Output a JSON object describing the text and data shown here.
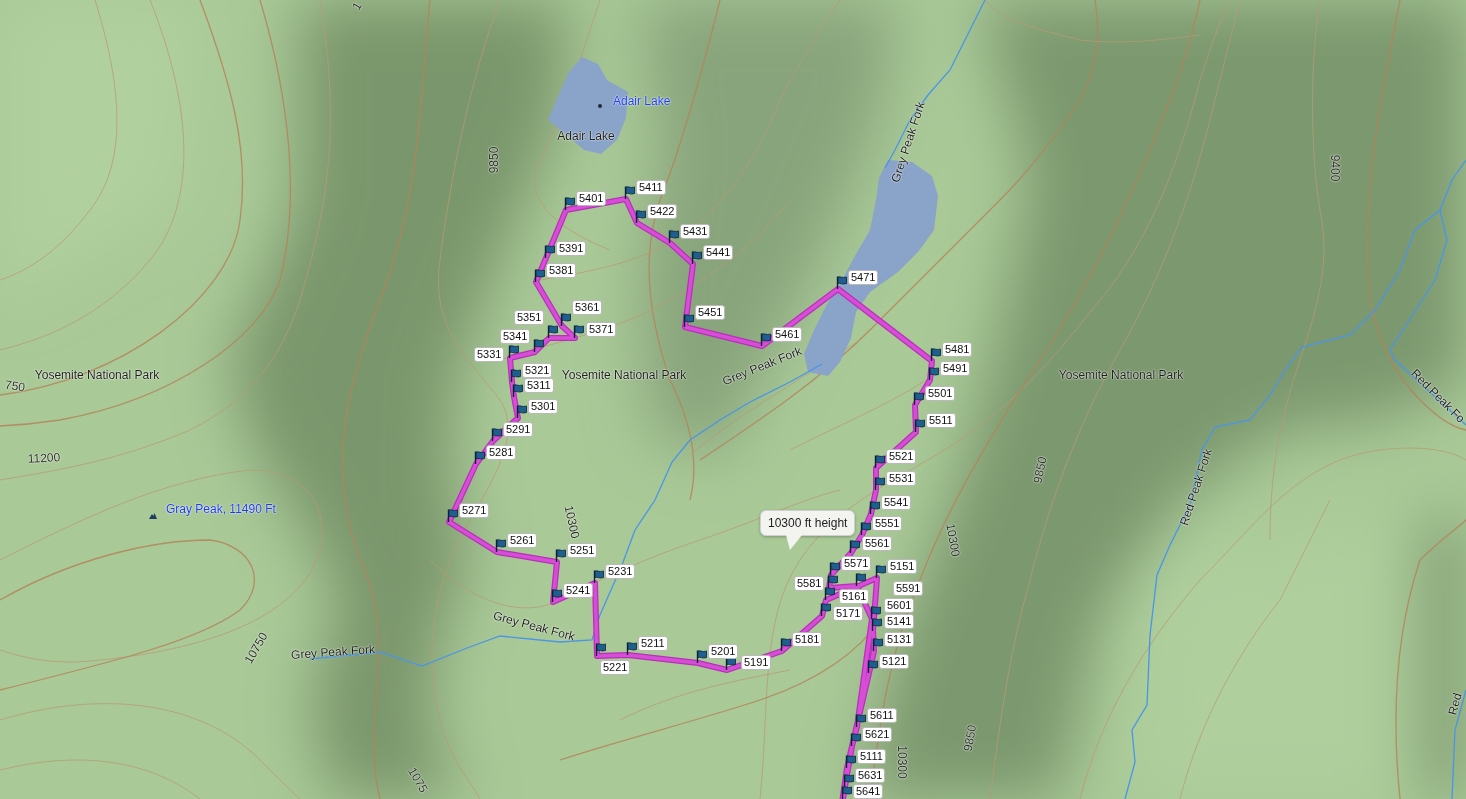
{
  "map": {
    "points_of_interest": [
      {
        "kind": "lake",
        "name": "Adair Lake"
      },
      {
        "kind": "peak",
        "name": "Gray Peak, 11490 Ft"
      }
    ],
    "place_labels": [
      "Adair Lake",
      "Yosemite National Park",
      "Yosemite National Park",
      "Yosemite National Park"
    ],
    "stream_labels": [
      "Grey Peak Fork",
      "Grey Peak Fork",
      "Grey Peak Fork",
      "Grey Peak Fork",
      "Red Peak Fork",
      "Red Peak Fo",
      "Red"
    ],
    "contour_labels": [
      "1",
      "9850",
      "750",
      "11200",
      "10750",
      "10300",
      "1075",
      "9400",
      "9850",
      "10300",
      "9850",
      "10300"
    ],
    "waypoints": [
      "5401",
      "5411",
      "5422",
      "5431",
      "5391",
      "5441",
      "5381",
      "5471",
      "5351",
      "5361",
      "5451",
      "5341",
      "5371",
      "5461",
      "5331",
      "5481",
      "5321",
      "5491",
      "5311",
      "5301",
      "5501",
      "5291",
      "5511",
      "5281",
      "5521",
      "5531",
      "5271",
      "5541",
      "5551",
      "5261",
      "5251",
      "5561",
      "5231",
      "5571",
      "5151",
      "5241",
      "5581",
      "5161",
      "5591",
      "5171",
      "5601",
      "5141",
      "5211",
      "5201",
      "5181",
      "5131",
      "5221",
      "5191",
      "5121",
      "5611",
      "5621",
      "5111",
      "5631",
      "5641"
    ],
    "tooltip": {
      "text": "10300 ft height"
    }
  }
}
